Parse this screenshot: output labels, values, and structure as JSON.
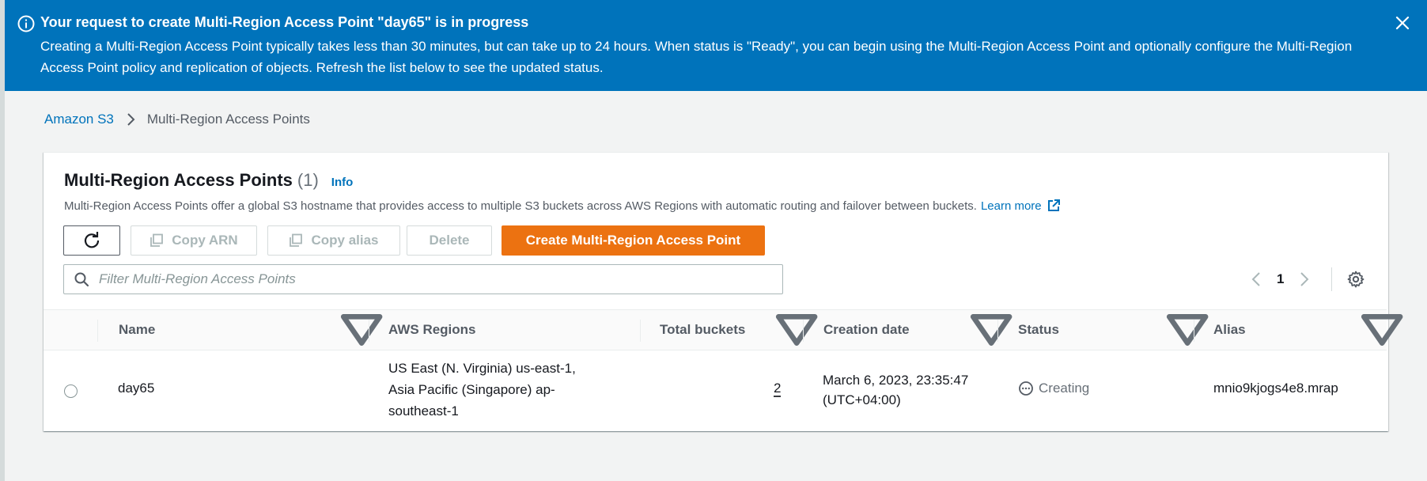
{
  "flash": {
    "title": "Your request to create Multi-Region Access Point \"day65\" is in progress",
    "message": "Creating a Multi-Region Access Point typically takes less than 30 minutes, but can take up to 24 hours. When status is \"Ready\", you can begin using the Multi-Region Access Point and optionally configure the Multi-Region Access Point policy and replication of objects. Refresh the list below to see the updated status.",
    "color": "#0073bb"
  },
  "breadcrumb": {
    "root": "Amazon S3",
    "current": "Multi-Region Access Points"
  },
  "panel": {
    "title": "Multi-Region Access Points",
    "count": "(1)",
    "info": "Info",
    "description": "Multi-Region Access Points offer a global S3 hostname that provides access to multiple S3 buckets across AWS Regions with automatic routing and failover between buckets.",
    "learn_more": "Learn more"
  },
  "toolbar": {
    "copy_arn": "Copy ARN",
    "copy_alias": "Copy alias",
    "delete": "Delete",
    "create": "Create Multi-Region Access Point",
    "create_color": "#ec7211"
  },
  "search": {
    "placeholder": "Filter Multi-Region Access Points"
  },
  "pagination": {
    "current_page": "1"
  },
  "table": {
    "columns": [
      "Name",
      "AWS Regions",
      "Total buckets",
      "Creation date",
      "Status",
      "Alias"
    ],
    "rows": [
      {
        "name": "day65",
        "regions_line1": "US East (N. Virginia) us-east-1,",
        "regions_line2": "Asia Pacific (Singapore) ap-southeast-1",
        "total_buckets": "2",
        "creation_date": "March 6, 2023, 23:35:47 (UTC+04:00)",
        "status": "Creating",
        "alias": "mnio9kjogs4e8.mrap"
      }
    ]
  }
}
